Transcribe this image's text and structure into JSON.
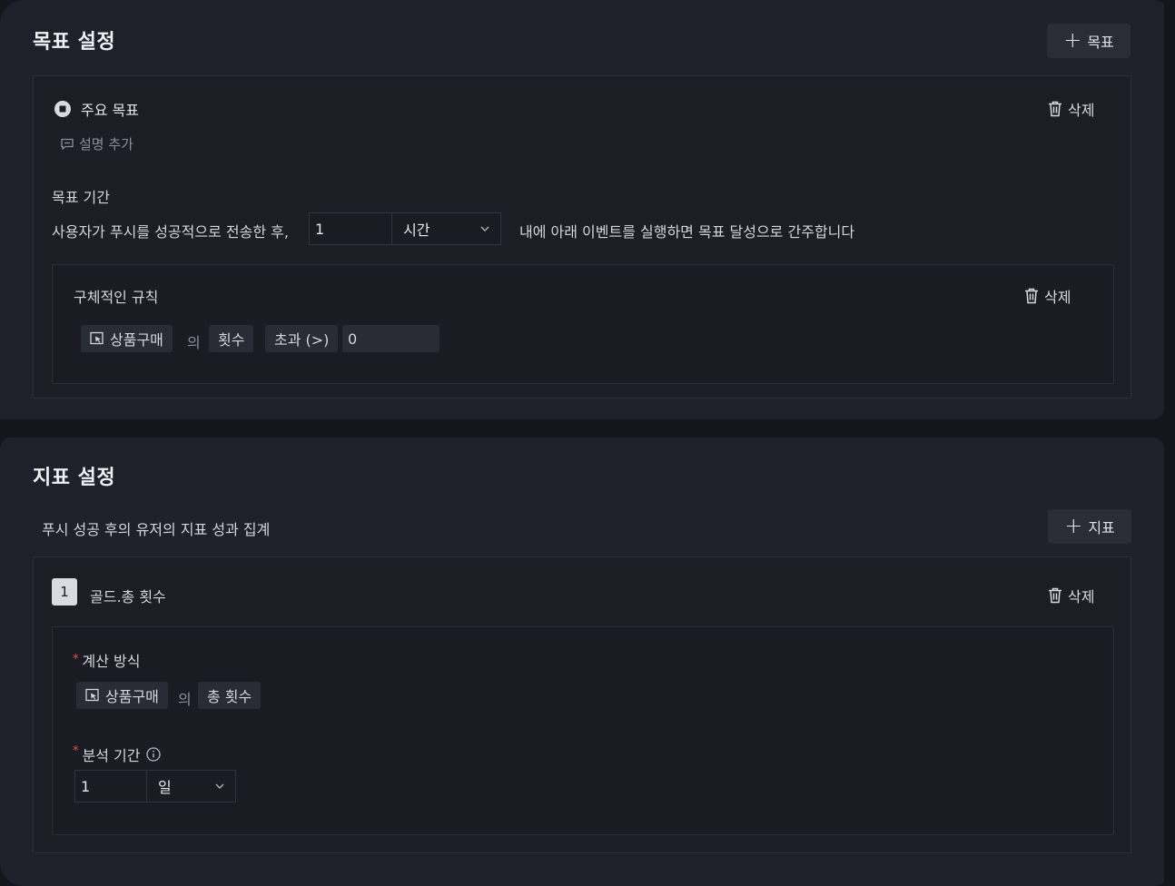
{
  "goal_section": {
    "title": "목표 설정",
    "add_button": "목표",
    "primary_goal_label": "주요 목표",
    "delete_label": "삭제",
    "add_description": "설명 추가",
    "period_title": "목표 기간",
    "period_prefix": "사용자가 푸시를 성공적으로 전송한 후,",
    "period_value": "1",
    "period_unit": "시간",
    "period_suffix": "내에 아래 이벤트를 실행하면 목표 달성으로 간주합니다",
    "rule": {
      "title": "구체적인 규칙",
      "delete_label": "삭제",
      "event_chip": "상품구매",
      "connector": "의",
      "metric_chip": "횟수",
      "operator_chip": "초과 (>)",
      "value": "0"
    }
  },
  "metric_section": {
    "title": "지표 설정",
    "subtitle": "푸시 성공  후의 유저의 지표 성과 집계",
    "add_button": "지표",
    "metric": {
      "index": "1",
      "name": "골드.총 횟수",
      "delete_label": "삭제",
      "calc_label": "계산 방식",
      "event_chip": "상품구매",
      "connector": "의",
      "agg_chip": "총 횟수",
      "period_label": "분석 기간",
      "period_value": "1",
      "period_unit": "일"
    }
  }
}
